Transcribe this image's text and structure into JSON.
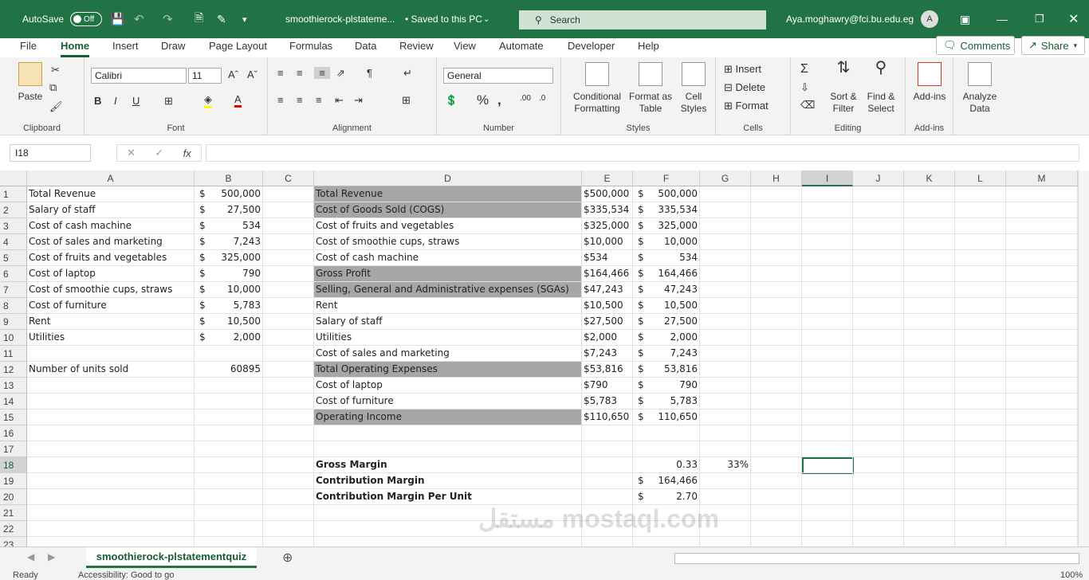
{
  "titlebar": {
    "autosave_label": "AutoSave",
    "autosave_state": "Off",
    "doc_title": "smoothierock-plstateme...",
    "saved_status": "• Saved to this PC",
    "search_placeholder": "Search",
    "user_email": "Aya.moghawry@fci.bu.edu.eg",
    "avatar_initial": "A"
  },
  "menu": {
    "tabs": [
      "File",
      "Home",
      "Insert",
      "Draw",
      "Page Layout",
      "Formulas",
      "Data",
      "Review",
      "View",
      "Automate",
      "Developer",
      "Help"
    ],
    "active": "Home",
    "comments_label": "Comments",
    "share_label": "Share"
  },
  "ribbon": {
    "clipboard": {
      "label": "Clipboard",
      "paste": "Paste"
    },
    "font": {
      "label": "Font",
      "name": "Calibri",
      "size": "11"
    },
    "alignment": {
      "label": "Alignment"
    },
    "number": {
      "label": "Number",
      "format": "General"
    },
    "styles": {
      "label": "Styles",
      "conditional": "Conditional Formatting",
      "format_table": "Format as Table",
      "cell_styles": "Cell Styles"
    },
    "cells": {
      "label": "Cells",
      "insert": "Insert",
      "delete": "Delete",
      "format": "Format"
    },
    "editing": {
      "label": "Editing",
      "sort": "Sort & Filter",
      "find": "Find & Select"
    },
    "addins": {
      "label": "Add-ins",
      "addins": "Add-ins"
    },
    "analyze": {
      "label": "Analyze Data"
    }
  },
  "formula_bar": {
    "name_box": "I18",
    "formula": ""
  },
  "columns": [
    "A",
    "B",
    "C",
    "D",
    "E",
    "F",
    "G",
    "H",
    "I",
    "J",
    "K",
    "L",
    "M"
  ],
  "rows": [
    "1",
    "2",
    "3",
    "4",
    "5",
    "6",
    "7",
    "8",
    "9",
    "10",
    "11",
    "12",
    "13",
    "14",
    "15",
    "16",
    "17",
    "18",
    "19",
    "20",
    "21",
    "22",
    "23"
  ],
  "cells": {
    "A": [
      "Total Revenue",
      "Salary of staff",
      "Cost of cash machine",
      "Cost of sales and marketing",
      "Cost of fruits and vegetables",
      "Cost of laptop",
      "Cost of smoothie cups, straws",
      "Cost of furniture",
      "Rent",
      "Utilities",
      "",
      "Number of units sold",
      "",
      "",
      "",
      "",
      "",
      "",
      "",
      "",
      "",
      "",
      ""
    ],
    "B_sym": [
      "$",
      "$",
      "$",
      "$",
      "$",
      "$",
      "$",
      "$",
      "$",
      "$",
      "",
      "",
      "",
      "",
      "",
      "",
      "",
      "",
      "",
      "",
      "",
      "",
      ""
    ],
    "B_val": [
      "500,000",
      "27,500",
      "534",
      "7,243",
      "325,000",
      "790",
      "10,000",
      "5,783",
      "10,500",
      "2,000",
      "",
      "60895",
      "",
      "",
      "",
      "",
      "",
      "",
      "",
      "",
      "",
      "",
      ""
    ],
    "D": [
      "Total Revenue",
      "Cost of Goods Sold (COGS)",
      "Cost of fruits and vegetables",
      "Cost of smoothie cups, straws",
      "Cost of cash machine",
      "Gross Profit",
      "Selling, General and Administrative expenses (SGAs)",
      "Rent",
      "Salary of staff",
      "Utilities",
      "Cost of sales and marketing",
      "Total Operating Expenses",
      "Cost of laptop",
      "Cost of furniture",
      "Operating Income",
      "",
      "",
      "Gross Margin",
      "Contribution Margin",
      "Contribution Margin Per Unit",
      "",
      "",
      ""
    ],
    "E": [
      "$500,000",
      "$335,534",
      "$325,000",
      "$10,000",
      "$534",
      "$164,466",
      "$47,243",
      "$10,500",
      "$27,500",
      "$2,000",
      "$7,243",
      "$53,816",
      "$790",
      "$5,783",
      "$110,650",
      "",
      "",
      "",
      "",
      "",
      "",
      "",
      ""
    ],
    "F_sym": [
      "$",
      "$",
      "$",
      "$",
      "$",
      "$",
      "$",
      "$",
      "$",
      "$",
      "$",
      "$",
      "$",
      "$",
      "$",
      "",
      "",
      "",
      "$",
      "$",
      "",
      "",
      ""
    ],
    "F_val": [
      "500,000",
      "335,534",
      "325,000",
      "10,000",
      "534",
      "164,466",
      "47,243",
      "10,500",
      "27,500",
      "2,000",
      "7,243",
      "53,816",
      "790",
      "5,783",
      "110,650",
      "",
      "",
      "0.33",
      "164,466",
      "2.70",
      "",
      "",
      ""
    ],
    "G": [
      "",
      "",
      "",
      "",
      "",
      "",
      "",
      "",
      "",
      "",
      "",
      "",
      "",
      "",
      "",
      "",
      "",
      "33%",
      "",
      "",
      "",
      "",
      ""
    ]
  },
  "gray_rows_D": [
    0,
    1,
    5,
    6,
    11,
    14
  ],
  "bold_rows_D": [
    17,
    18,
    19
  ],
  "sheet_tab": "smoothierock-plstatementquiz",
  "status": {
    "ready": "Ready",
    "accessibility": "Accessibility: Good to go",
    "zoom": "100%"
  },
  "watermark": "مستقل mostaql.com"
}
